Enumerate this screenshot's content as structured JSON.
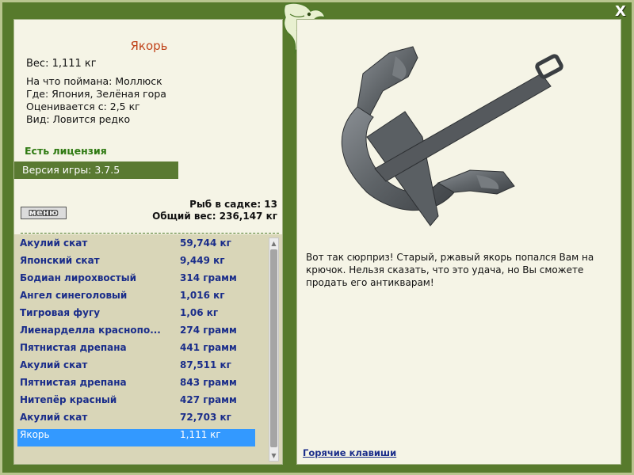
{
  "window": {
    "close_label": "X"
  },
  "catch": {
    "title": "Якорь",
    "weight": "Вес: 1,111 кг",
    "caught_on": "На что поймана: Моллюск",
    "location": "Где: Япония, Зелёная гора",
    "valued_from": "Оценивается с: 2,5 кг",
    "rarity": "Вид: Ловится редко"
  },
  "license_text": "Есть лицензия",
  "version_text": "Версия игры: 3.7.5",
  "menu_label": "меню",
  "stats": {
    "fish_count": "Рыб в садке: 13",
    "total_weight": "Общий вес: 236,147 кг"
  },
  "fish_list": [
    {
      "name": "Акулий скат",
      "weight": "59,744 кг"
    },
    {
      "name": "Японский скат",
      "weight": "9,449 кг"
    },
    {
      "name": "Бодиан лирохвостый",
      "weight": "314 грамм"
    },
    {
      "name": "Ангел синеголовый",
      "weight": "1,016 кг"
    },
    {
      "name": "Тигровая фугу",
      "weight": "1,06 кг"
    },
    {
      "name": "Лиенарделла краснопо...",
      "weight": "274 грамм"
    },
    {
      "name": "Пятнистая дрепана",
      "weight": "441 грамм"
    },
    {
      "name": "Акулий скат",
      "weight": "87,511 кг"
    },
    {
      "name": "Пятнистая дрепана",
      "weight": "843 грамм"
    },
    {
      "name": "Нитепёр красный",
      "weight": "427 грамм"
    },
    {
      "name": "Акулий скат",
      "weight": "72,703 кг"
    },
    {
      "name": "Якорь",
      "weight": "1,111 кг",
      "selected": true
    }
  ],
  "description": "Вот так сюрприз! Старый, ржавый якорь попался Вам на крючок. Нельзя сказать, что это удача, но Вы сможете продать его антикварам!",
  "hotkeys_label": "Горячие клавиши",
  "colors": {
    "frame": "#577a2c",
    "panel": "#f5f4e6",
    "list_bg": "#d9d6b8",
    "title": "#c0431a",
    "license": "#2f7a12",
    "list_text": "#1a2d8a",
    "selection": "#3399ff"
  },
  "icons": {
    "logo": "fish-logo-icon",
    "close": "close-icon",
    "image": "anchor-image"
  }
}
